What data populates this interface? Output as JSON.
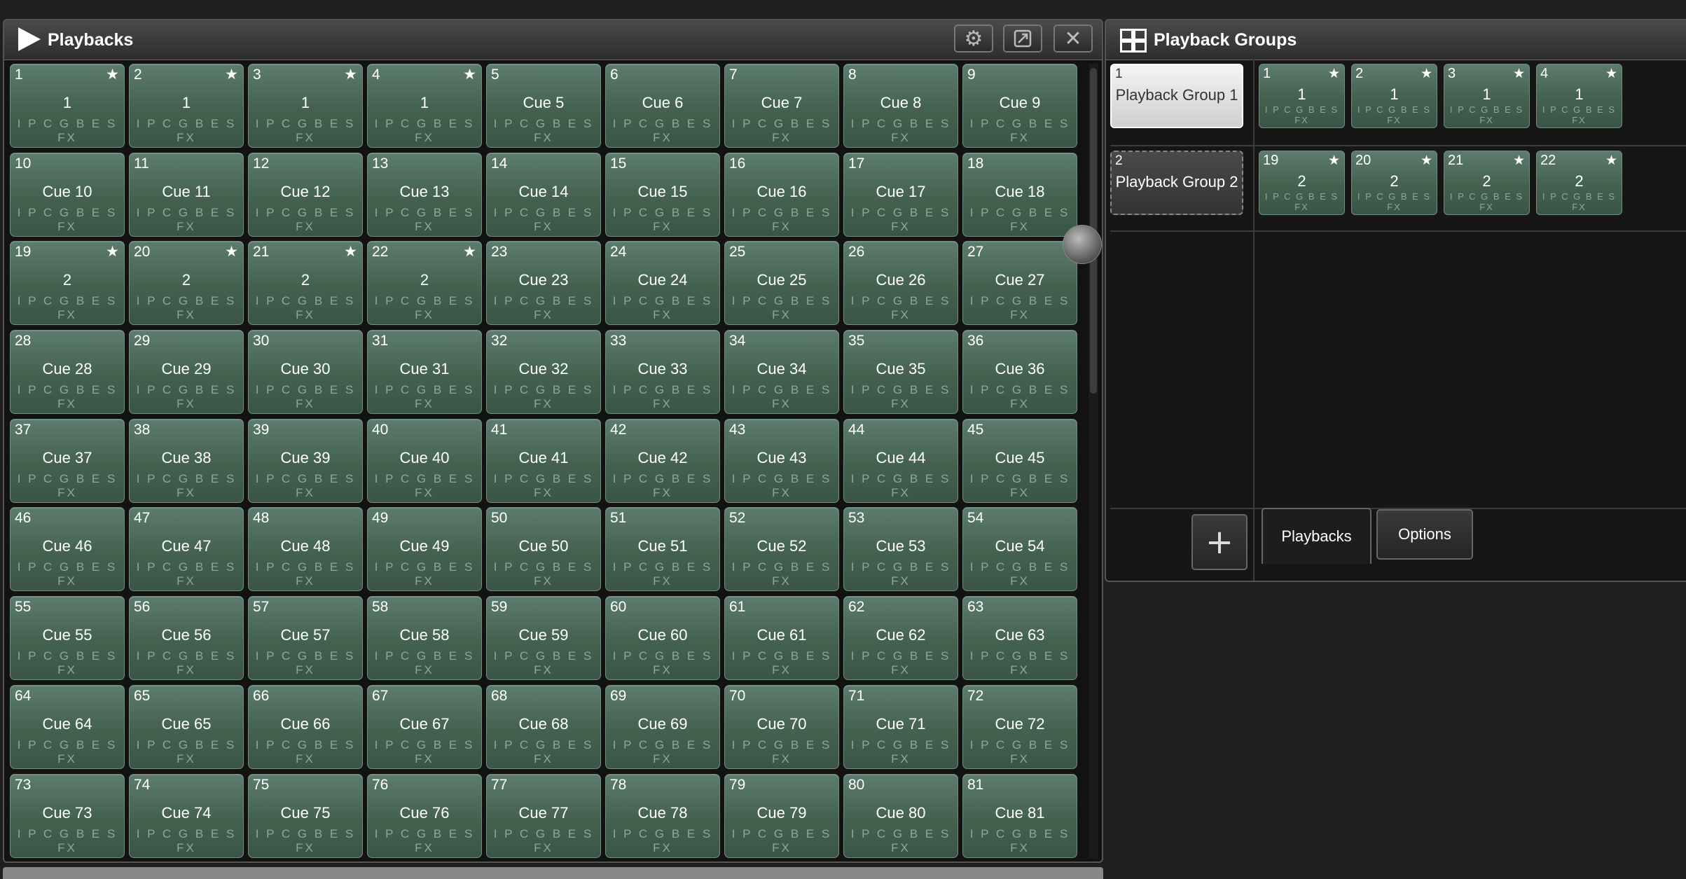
{
  "playbacks": {
    "title": "Playbacks",
    "fx_label": "I P C G B E S FX",
    "tiles": [
      {
        "num": "1",
        "name": "1",
        "star": true
      },
      {
        "num": "2",
        "name": "1",
        "star": true
      },
      {
        "num": "3",
        "name": "1",
        "star": true
      },
      {
        "num": "4",
        "name": "1",
        "star": true
      },
      {
        "num": "5",
        "name": "Cue 5"
      },
      {
        "num": "6",
        "name": "Cue 6"
      },
      {
        "num": "7",
        "name": "Cue 7"
      },
      {
        "num": "8",
        "name": "Cue 8"
      },
      {
        "num": "9",
        "name": "Cue 9"
      },
      {
        "num": "10",
        "name": "Cue 10"
      },
      {
        "num": "11",
        "name": "Cue 11"
      },
      {
        "num": "12",
        "name": "Cue 12"
      },
      {
        "num": "13",
        "name": "Cue 13"
      },
      {
        "num": "14",
        "name": "Cue 14"
      },
      {
        "num": "15",
        "name": "Cue 15"
      },
      {
        "num": "16",
        "name": "Cue 16"
      },
      {
        "num": "17",
        "name": "Cue 17"
      },
      {
        "num": "18",
        "name": "Cue 18"
      },
      {
        "num": "19",
        "name": "2",
        "star": true
      },
      {
        "num": "20",
        "name": "2",
        "star": true
      },
      {
        "num": "21",
        "name": "2",
        "star": true
      },
      {
        "num": "22",
        "name": "2",
        "star": true
      },
      {
        "num": "23",
        "name": "Cue 23"
      },
      {
        "num": "24",
        "name": "Cue 24"
      },
      {
        "num": "25",
        "name": "Cue 25"
      },
      {
        "num": "26",
        "name": "Cue 26"
      },
      {
        "num": "27",
        "name": "Cue 27"
      },
      {
        "num": "28",
        "name": "Cue 28"
      },
      {
        "num": "29",
        "name": "Cue 29"
      },
      {
        "num": "30",
        "name": "Cue 30"
      },
      {
        "num": "31",
        "name": "Cue 31"
      },
      {
        "num": "32",
        "name": "Cue 32"
      },
      {
        "num": "33",
        "name": "Cue 33"
      },
      {
        "num": "34",
        "name": "Cue 34"
      },
      {
        "num": "35",
        "name": "Cue 35"
      },
      {
        "num": "36",
        "name": "Cue 36"
      },
      {
        "num": "37",
        "name": "Cue 37"
      },
      {
        "num": "38",
        "name": "Cue 38"
      },
      {
        "num": "39",
        "name": "Cue 39"
      },
      {
        "num": "40",
        "name": "Cue 40"
      },
      {
        "num": "41",
        "name": "Cue 41"
      },
      {
        "num": "42",
        "name": "Cue 42"
      },
      {
        "num": "43",
        "name": "Cue 43"
      },
      {
        "num": "44",
        "name": "Cue 44"
      },
      {
        "num": "45",
        "name": "Cue 45"
      },
      {
        "num": "46",
        "name": "Cue 46"
      },
      {
        "num": "47",
        "name": "Cue 47"
      },
      {
        "num": "48",
        "name": "Cue 48"
      },
      {
        "num": "49",
        "name": "Cue 49"
      },
      {
        "num": "50",
        "name": "Cue 50"
      },
      {
        "num": "51",
        "name": "Cue 51"
      },
      {
        "num": "52",
        "name": "Cue 52"
      },
      {
        "num": "53",
        "name": "Cue 53"
      },
      {
        "num": "54",
        "name": "Cue 54"
      },
      {
        "num": "55",
        "name": "Cue 55"
      },
      {
        "num": "56",
        "name": "Cue 56"
      },
      {
        "num": "57",
        "name": "Cue 57"
      },
      {
        "num": "58",
        "name": "Cue 58"
      },
      {
        "num": "59",
        "name": "Cue 59"
      },
      {
        "num": "60",
        "name": "Cue 60"
      },
      {
        "num": "61",
        "name": "Cue 61"
      },
      {
        "num": "62",
        "name": "Cue 62"
      },
      {
        "num": "63",
        "name": "Cue 63"
      },
      {
        "num": "64",
        "name": "Cue 64"
      },
      {
        "num": "65",
        "name": "Cue 65"
      },
      {
        "num": "66",
        "name": "Cue 66"
      },
      {
        "num": "67",
        "name": "Cue 67"
      },
      {
        "num": "68",
        "name": "Cue 68"
      },
      {
        "num": "69",
        "name": "Cue 69"
      },
      {
        "num": "70",
        "name": "Cue 70"
      },
      {
        "num": "71",
        "name": "Cue 71"
      },
      {
        "num": "72",
        "name": "Cue 72"
      },
      {
        "num": "73",
        "name": "Cue 73"
      },
      {
        "num": "74",
        "name": "Cue 74"
      },
      {
        "num": "75",
        "name": "Cue 75"
      },
      {
        "num": "76",
        "name": "Cue 76"
      },
      {
        "num": "77",
        "name": "Cue 77"
      },
      {
        "num": "78",
        "name": "Cue 78"
      },
      {
        "num": "79",
        "name": "Cue 79"
      },
      {
        "num": "80",
        "name": "Cue 80"
      },
      {
        "num": "81",
        "name": "Cue 81"
      }
    ],
    "icons": {
      "settings": "gear-icon",
      "undock": "undock-icon",
      "close": "close-icon",
      "title": "play-icon"
    }
  },
  "groups": {
    "title": "Playback Groups",
    "fx_label": "I P C G B E S FX",
    "rows": [
      {
        "num": "1",
        "name": "Playback Group 1",
        "selected": true,
        "members": [
          {
            "num": "1",
            "name": "1"
          },
          {
            "num": "2",
            "name": "1"
          },
          {
            "num": "3",
            "name": "1"
          },
          {
            "num": "4",
            "name": "1"
          }
        ]
      },
      {
        "num": "2",
        "name": "Playback Group 2",
        "selected": false,
        "members": [
          {
            "num": "19",
            "name": "2"
          },
          {
            "num": "20",
            "name": "2"
          },
          {
            "num": "21",
            "name": "2"
          },
          {
            "num": "22",
            "name": "2"
          }
        ]
      }
    ],
    "add_label": "+",
    "tabs": [
      {
        "label": "Playbacks",
        "active": true
      },
      {
        "label": "Options",
        "active": false
      }
    ]
  },
  "colors": {
    "tile_bg": "#4a6b5a",
    "background": "#1f1f20",
    "selected_group": "#e6e6e6"
  }
}
